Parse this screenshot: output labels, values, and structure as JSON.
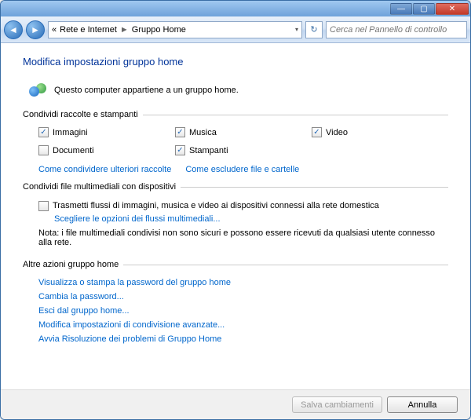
{
  "window": {
    "min_icon": "—",
    "max_icon": "▢",
    "close_icon": "✕"
  },
  "nav": {
    "back_icon": "◄",
    "fwd_icon": "►",
    "chevrons": "«",
    "breadcrumb_parent": "Rete e Internet",
    "breadcrumb_current": "Gruppo Home",
    "sep": "►",
    "dropdown": "▾",
    "refresh_icon": "↻",
    "search_placeholder": "Cerca nel Pannello di controllo"
  },
  "page": {
    "title": "Modifica impostazioni gruppo home",
    "info_text": "Questo computer appartiene a un gruppo home."
  },
  "share": {
    "header": "Condividi raccolte e stampanti",
    "items": [
      {
        "label": "Immagini",
        "checked": true
      },
      {
        "label": "Musica",
        "checked": true
      },
      {
        "label": "Video",
        "checked": true
      },
      {
        "label": "Documenti",
        "checked": false
      },
      {
        "label": "Stampanti",
        "checked": true
      }
    ],
    "link_more": "Come condividere ulteriori raccolte",
    "link_exclude": "Come escludere file e cartelle"
  },
  "media": {
    "header": "Condividi file multimediali con dispositivi",
    "stream_label": "Trasmetti flussi di immagini, musica e video ai dispositivi connessi alla rete domestica",
    "stream_checked": false,
    "stream_options_link": "Scegliere le opzioni dei flussi multimediali...",
    "note": "Nota: i file multimediali condivisi non sono sicuri e possono essere ricevuti da qualsiasi utente connesso alla rete."
  },
  "actions": {
    "header": "Altre azioni gruppo home",
    "links": [
      "Visualizza o stampa la password del gruppo home",
      "Cambia la password...",
      "Esci dal gruppo home...",
      "Modifica impostazioni di condivisione avanzate...",
      "Avvia Risoluzione dei problemi di Gruppo Home"
    ]
  },
  "footer": {
    "save": "Salva cambiamenti",
    "cancel": "Annulla"
  },
  "checkmark": "✓"
}
